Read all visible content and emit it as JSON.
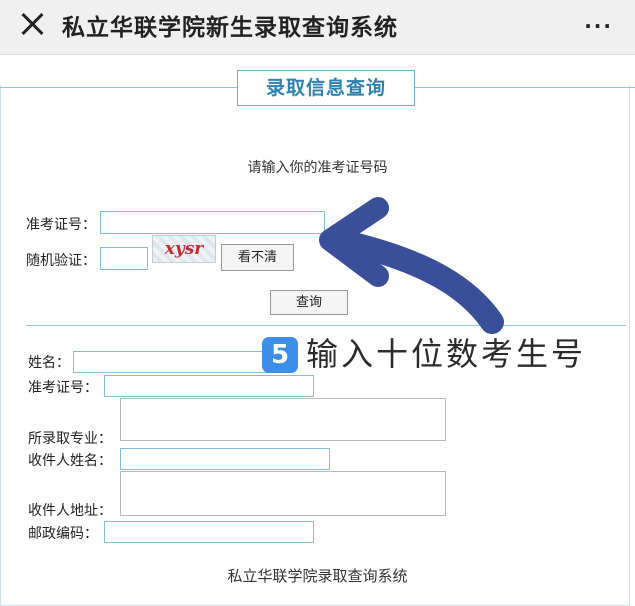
{
  "app": {
    "title": "私立华联学院新生录取查询系统",
    "more_label": "···"
  },
  "section": {
    "title": "录取信息查询"
  },
  "form": {
    "prompt": "请输入你的准考证号码",
    "exam_no_label": "准考证号：",
    "captcha_label": "随机验证：",
    "captcha_text": "xysr",
    "refresh_label": "看不清",
    "submit_label": "查询"
  },
  "results": {
    "name_label": "姓名：",
    "exam_no_label": "准考证号：",
    "major_label": "所录取专业：",
    "recipient_name_label": "收件人姓名：",
    "recipient_address_label": "收件人地址：",
    "postal_code_label": "邮政编码："
  },
  "annotation": {
    "step_number": "5",
    "handwritten_text": "输入十位数考生号",
    "arrow_color": "#3a4f9a"
  },
  "footer": {
    "text": "私立华联学院录取查询系统"
  }
}
